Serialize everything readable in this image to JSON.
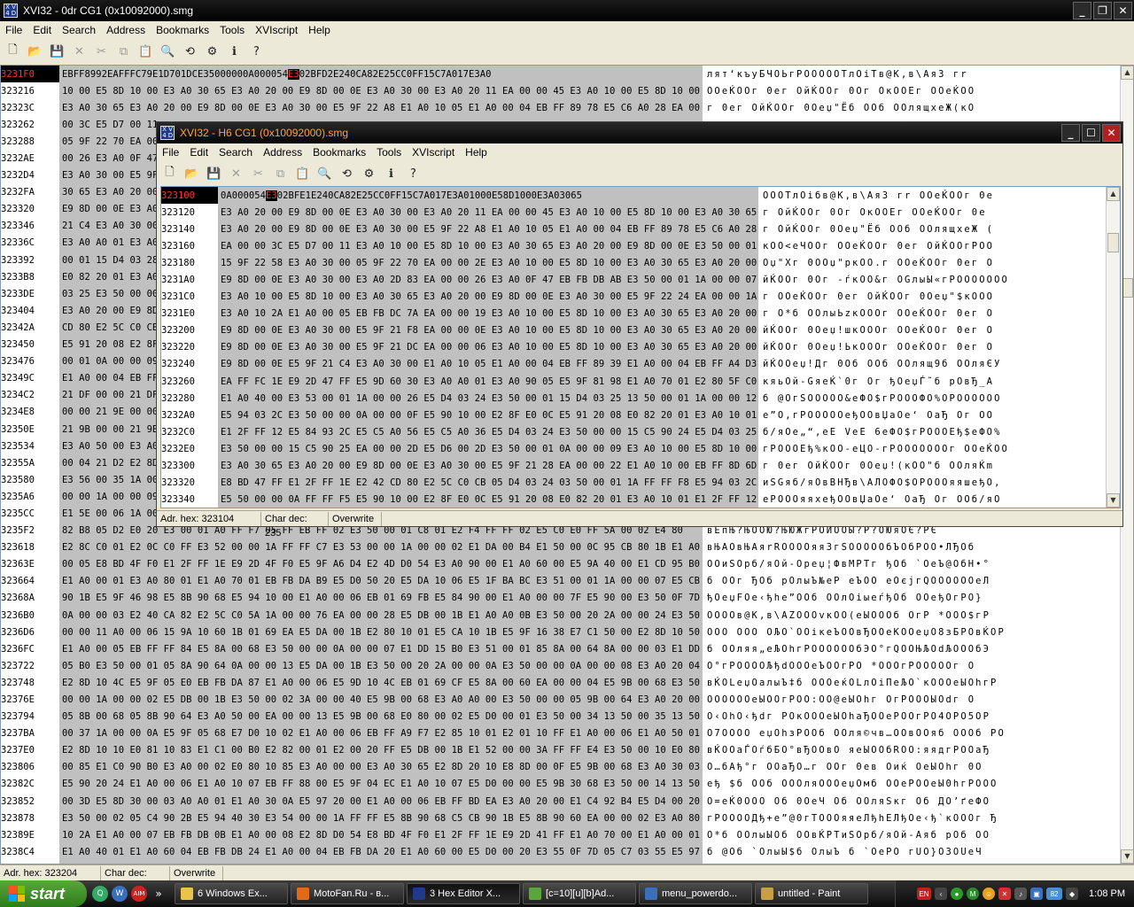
{
  "back_window": {
    "title": "XVI32 - 0dr CG1 (0x10092000).smg",
    "menu": [
      "File",
      "Edit",
      "Search",
      "Address",
      "Bookmarks",
      "Tools",
      "XVIscript",
      "Help"
    ],
    "status": {
      "adr_hex": "Adr. hex: 323204",
      "char_dec": "Char dec: 235",
      "mode": "Overwrite"
    },
    "rows": [
      {
        "addr": "3231F0",
        "hex": "EB FF 89 92 EA FF FC 79 E1 D7 01 DC E3 50 00 00 0A 00 00 54 E3 02 BF D2 E2 40 CA 82 E2 5C C0 FF 15 C7 A0 17 E3 A0",
        "text": "лят‘къуБЧОЬгРОООООТлОiТв@К,в\\АяЗ гr"
      },
      {
        "addr": "323216",
        "hex": "10 00 E5 8D 10 00 E3 A0 30 65 E3 A0 20 00 E9 8D 00 0E E3 A0 30 00 E3 A0 20 11 EA 00 00 45 E3 A0 10 00 E5 8D 10 00",
        "text": "ООеЌООг 0ег  ОйЌООг 0Ог  ОкООЕг ООеЌОО"
      },
      {
        "addr": "32323C",
        "hex": "E3 A0 30 65 E3 A0 20 00 E9 8D 00 0E E3 A0 30 00 E5 9F 22 A8 E1 A0 10 05 E1 A0 00 04 EB FF 89 78 E5 C6 A0 28 EA 00",
        "text": "г 0ег  ОйЌООг 0Оеџ\"Ёб ООб ООлящхеЖ(кО"
      },
      {
        "addr": "323262",
        "hex": "00 3C E5 D7 00 11",
        "text": ""
      },
      {
        "addr": "323288",
        "hex": "05 9F 22 70 EA 00",
        "text": ""
      },
      {
        "addr": "3232AE",
        "hex": "00 26 E3 A0 0F 47",
        "text": ""
      },
      {
        "addr": "3232D4",
        "hex": "E3 A0 30 00 E5 9F",
        "text": ""
      },
      {
        "addr": "3232FA",
        "hex": "30 65 E3 A0 20 00",
        "text": ""
      },
      {
        "addr": "323320",
        "hex": "E9 8D 00 0E E3 A0",
        "text": ""
      },
      {
        "addr": "323346",
        "hex": "21 C4 E3 A0 30 00",
        "text": ""
      },
      {
        "addr": "32336C",
        "hex": "E3 A0 A0 01 E3 A0",
        "text": ""
      },
      {
        "addr": "323392",
        "hex": "00 01 15 D4 03 28",
        "text": ""
      },
      {
        "addr": "3233B8",
        "hex": "E0 82 20 01 E3 A0",
        "text": ""
      },
      {
        "addr": "3233DE",
        "hex": "03 25 E3 50 00 00",
        "text": ""
      },
      {
        "addr": "323404",
        "hex": "E3 A0 20 00 E9 8D",
        "text": ""
      },
      {
        "addr": "32342A",
        "hex": "CD 80 E2 5C C0 CB",
        "text": ""
      },
      {
        "addr": "323450",
        "hex": "E5 91 20 08 E2 8F",
        "text": ""
      },
      {
        "addr": "323476",
        "hex": "00 01 0A 00 00 09",
        "text": ""
      },
      {
        "addr": "32349C",
        "hex": "E1 A0 00 04 EB FF",
        "text": ""
      },
      {
        "addr": "3234C2",
        "hex": "21 DF 00 00 21 DF",
        "text": ""
      },
      {
        "addr": "3234E8",
        "hex": "00 00 21 9E 00 00",
        "text": ""
      },
      {
        "addr": "32350E",
        "hex": "21 9B 00 00 21 9B",
        "text": ""
      },
      {
        "addr": "323534",
        "hex": "E3 A0 50 00 E3 A0",
        "text": ""
      },
      {
        "addr": "32355A",
        "hex": "00 04 21 D2 E2 8D",
        "text": ""
      },
      {
        "addr": "323580",
        "hex": "E3 56 00 35 1A 00",
        "text": ""
      },
      {
        "addr": "3235A6",
        "hex": "00 00 1A 00 00 09",
        "text": ""
      },
      {
        "addr": "3235CC",
        "hex": "E1 5E 00 06 1A 00",
        "text": ""
      },
      {
        "addr": "3235F2",
        "hex": "82 B8 05 D2 E0 20 E3 00 01 A0 FF F7 05 FF EB FF 02 E3 50 00 01 C8 01 E2 F4 FF FF 02 E5 C0 E0 FF 5A 00 02 E4 80",
        "text": "вЕпЊ?ЊООЮ?ЊЮЖгРОИООЫ?Р?ОЮяОЄ?РЄ"
      },
      {
        "addr": "323618",
        "hex": "E2 8C C0 01 E2 0C C0 FF E3 52 00 00 1A FF FF C7 E3 53 00 00 1A 00 00 02 E1 DA 00 B4 E1 50 00 0C 95 CB 80 1B E1 A0",
        "text": "вЊАОвЊАяrRООООяяЗгSОООООбЪОбРОО•ЛЂОб"
      },
      {
        "addr": "32363E",
        "hex": "00 05 E8 BD 4F F0 E1 2F FF 1E E9 2D 4F F0 E5 9F A6 D4 E2 4D D0 54 E3 A0 90 00 E1 A0 60 00 E5 9A 40 00 E1 CD 95 B0",
        "text": "ООиЅОрб/яОй-Ореџ¦ФвМРТг ђОб `ОеЪ@ОбН•°"
      },
      {
        "addr": "323664",
        "hex": "E1 A0 00 01 E3 A0 80 01 E1 A0 70 01 EB FB DA B9 E5 D0 50 20 E5 DA 10 06 E5 1F BA BC E3 51 00 01 1A 00 00 07 E5 CB",
        "text": "б ООг ЂОб pОлыЪ№еР еЪОО еОєјгQООООООеЛ"
      },
      {
        "addr": "32368A",
        "hex": "90 1B E5 9F 46 98 E5 8B 90 68 E5 94 10 00 E1 A0 00 06 EB 01 69 FB E5 84 90 00 E1 A0 00 00 7F E5 90 00 E3 50 0F 7D",
        "text": "ђОеџFОе‹ђhе”ООб ООлОiыеѓђОб ООеђОгPО}"
      },
      {
        "addr": "3236B0",
        "hex": "0A 00 00 03 E2 40 CA 82 E2 5C C0 5A 1A 00 00 76 EA 00 00 28 E5 DB 00 1B E1 A0 A0 0B E3 50 00 20 2A 00 00 24 E3 50",
        "text": "ОООOв@К,в\\АZОООvкОО(еЫОООб  ОгP *ООО$гР"
      },
      {
        "addr": "3236D6",
        "hex": "00 00 11 A0 00 06 15 9A 10 60 1B 01 69 EA E5 DA 00 1B E2 80 10 01 E5 CA 10 1B E5 9F 16 38 E7 C1 50 00 E2 8D 10 50",
        "text": "ООО ООО ОЉО`ООiкеЪООвЂООеКООеџО8зБРОвЌОР"
      },
      {
        "addr": "3236FC",
        "hex": "E1 A0 00 05 EB FF FF 84 E5 8A 00 68 E3 50 00 00 0A 00 00 07 E1 DD 15 B0 E3 51 00 01 85 8A 00 64 8A 00 00 03 E1 DD",
        "text": "б ООляя„еЉОhгРООООООбЭО°гQООЊЉОdЉОООбЭ"
      },
      {
        "addr": "323722",
        "hex": "05 B0 E3 50 00 01 05 8A 90 64 0A 00 00 13 E5 DA 00 1B E3 50 00 20 2A 00 00 0A E3 50 00 00 0A 00 00 08 E3 A0 20 04",
        "text": "О°гРООООЉђdОООеЪООгРО *ОООгРОООООг  О"
      },
      {
        "addr": "323748",
        "hex": "E2 8D 10 4C E5 9F 05 E0 EB FB DA 87 E1 A0 00 06 E5 9D 10 4C EB 01 69 CF E5 8A 00 60 EA 00 00 04 E5 9B 00 68 E3 50",
        "text": "вЌОLеџОалыЪ‡б ОООеќОLлОiПеЉО`кОООеЫОhгР"
      },
      {
        "addr": "32376E",
        "hex": "00 00 1A 00 00 02 E5 DB 00 1B E3 50 00 02 3A 00 00 40 E5 9B 00 68 E3 A0 A0 00 E3 50 00 00 05 9B 00 64 E3 A0 20 00",
        "text": "ООООООеЫООгРОО:ОО@еЫОhг  ОгРОООЫОdг  О"
      },
      {
        "addr": "323794",
        "hex": "05 8B 00 68 05 8B 90 64 E3 A0 50 00 EA 00 00 13 E5 9B 00 68 E0 80 00 02 E5 D0 00 01 E3 50 00 34 13 50 00 35 13 50",
        "text": "О‹ОhО‹ђdг POкОООеЫОhаЂООеРООгРО4ОРО5ОР"
      },
      {
        "addr": "3237BA",
        "hex": "00 37 1A 00 00 0A E5 9F 05 68 E7 D0 10 02 E1 A0 00 06 EB FF A9 F7 E2 85 10 01 E2 01 10 FF E1 A0 00 06 E1 A0 50 01",
        "text": "О7ОООО еџОhзРООб ООля©чв…ООвООяб ОООб РО"
      },
      {
        "addr": "3237E0",
        "hex": "E2 8D 10 10 E0 81 10 83 E1 C1 00 B0 E2 82 00 01 E2 00 20 FF E5 DB 00 1B E1 52 00 00 3A FF FF E4 E3 50 00 10 E0 80",
        "text": "вЌООаЃОѓбБО°вЂООвО яеЫООбRОО:яядгРООаЂ"
      },
      {
        "addr": "323806",
        "hex": "00 85 E1 C0 90 B0 E3 A0 00 02 E0 80 10 85 E3 A0 00 00 E3 A0 30 65 E2 8D 20 10 E8 8D 00 0F E5 9B 00 68 E3 A0 30 03",
        "text": "О…бАђ°г ООаЂО…г ООг 0ев Оиќ ОеЫОhг 0О"
      },
      {
        "addr": "32382C",
        "hex": "E5 90 20 24 E1 A0 00 06 E1 A0 10 07 EB FF 88 00 E5 9F 04 EC E1 A0 10 07 E5 D0 00 00 E5 9B 30 68 E3 50 00 14 13 50",
        "text": "еђ $б ООб ОООляОООеџОмб ООеРООеЫ0hгРООО"
      },
      {
        "addr": "323852",
        "hex": "00 3D E5 8D 30 00 03 A0 A0 01 E1 A0 30 0A E5 97 20 00 E1 A0 00 06 EB FF BD EA E3 A0 20 00 E1 C4 92 B4 E5 D4 00 20",
        "text": "О=еЌ0ООО  Об 0ОеЧ Об ООляЅкг Об ДО’ґеФО "
      },
      {
        "addr": "323878",
        "hex": "E3 50 00 02 05 C4 90 2B E5 94 40 30 E3 54 00 00 1A FF FF E5 8B 90 68 C5 CB 90 1B E5 8B 90 60 EA 00 00 02 E3 A0 80",
        "text": "гРООООДђ+е”@0гТОООяяеЛђhЕЛђОе‹ђ`кОООг Ђ"
      },
      {
        "addr": "32389E",
        "hex": "10 2A E1 A0 00 07 EB FB DB 0B E1 A0 00 08 E2 8D D0 54 E8 BD 4F F0 E1 2F FF 1E E9 2D 41 FF E1 A0 70 00 E1 A0 00 01",
        "text": "О*б ООлыЫОб ООвЌРТиЅОрб/яОй-Аяб pОб ОО"
      },
      {
        "addr": "3238C4",
        "hex": "E1 A0 40 01 E1 A0 60 04 EB FB DB 24 E1 A0 00 04 EB FB DA 20 E1 A0 60 00 E5 D0 00 20 E3 55 0F 7D 05 C7 03 55 E5 97",
        "text": "б @Об `ОлыЫ$б ОлыЪ б `ОеРО гUО}ОЗОUеЧ"
      }
    ]
  },
  "front_window": {
    "title": "XVI32 - H6 CG1 (0x10092000).smg",
    "menu": [
      "File",
      "Edit",
      "Search",
      "Address",
      "Bookmarks",
      "Tools",
      "XVIscript",
      "Help"
    ],
    "status": {
      "adr_hex": "Adr. hex: 323104",
      "char_dec": "Char dec: 235",
      "mode": "Overwrite"
    },
    "rows": [
      {
        "addr": "323100",
        "hex": "0A 00 00 54 E3 02 BF E1 E2 40 CA 82 E2 5C C0 FF 15 C7 A0 17 E3 A0 10 00 E5 8D 10 00 E3 A0 30 65",
        "text": "ОООТлОiбв@К,в\\АяЗ гr ООеЌООг 0е"
      },
      {
        "addr": "323120",
        "hex": "E3 A0 20 00 E9 8D 00 0E E3 A0 30 00 E3 A0 20 11 EA 00 00 45 E3 A0 10 00 E5 8D 10 00 E3 A0 30 65",
        "text": "г  ОйЌООг 0Ог  ОкООЕг ООеЌООг 0е"
      },
      {
        "addr": "323140",
        "hex": "E3 A0 20 00 E9 8D 00 0E E3 A0 30 00 E5 9F 22 A8 E1 A0 10 05 E1 A0 00 04 EB FF 89 78 E5 C6 A0 28",
        "text": "г  ОйЌООг 0Оеџ\"Ёб ООб ООлящхеЖ ("
      },
      {
        "addr": "323160",
        "hex": "EA 00 00 3C E5 D7 00 11 E3 A0 10 00 E5 8D 10 00 E3 A0 30 65 E3 A0 20 00 E9 8D 00 0E E3 50 00 01",
        "text": "кОО<еЧООг ООеЌООг 0ег  ОйЌООгРОО"
      },
      {
        "addr": "323180",
        "hex": "15 9F 22 58 E3 A0 30 00 05 9F 22 70 EA 00 00 2E E3 A0 10 00 E5 8D 10 00 E3 A0 30 65 E3 A0 20 00",
        "text": "Оџ\"Хг 0ООџ\"pкОО.г ООеЌООг 0ег  О"
      },
      {
        "addr": "3231A0",
        "hex": "E9 8D 00 0E E3 A0 30 00 E3 A0 2D 83 EA 00 00 26 E3 A0 0F 47 EB FB DB AB E3 50 00 01 1A 00 00 07",
        "text": "йЌООг 0Ог -ѓкОО&г ОGлыЫ«гРООООООО"
      },
      {
        "addr": "3231C0",
        "hex": "E3 A0 10 00 E5 8D 10 00 E3 A0 30 65 E3 A0 20 00 E9 8D 00 0E E3 A0 30 00 E5 9F 22 24 EA 00 00 1A",
        "text": "г ООеЌООг 0ег  ОйЌООг 0Оеџ\"$кООО"
      },
      {
        "addr": "3231E0",
        "hex": "E3 A0 10 2A E1 A0 00 05 EB FB DC 7A EA 00 00 19 E3 A0 10 00 E5 8D 10 00 E3 A0 30 65 E3 A0 20 00",
        "text": "г О*б ООлыЬzкОООг ООеЌООг 0ег  О"
      },
      {
        "addr": "323200",
        "hex": "E9 8D 00 0E E3 A0 30 00 E5 9F 21 F8 EA 00 00 0E E3 A0 10 00 E5 8D 10 00 E3 A0 30 65 E3 A0 20 00",
        "text": "йЌООг 0Оеџ!шкОООг ООеЌООг 0ег  О"
      },
      {
        "addr": "323220",
        "hex": "E9 8D 00 0E E3 A0 30 00 E5 9F 21 DC EA 00 00 06 E3 A0 10 00 E5 8D 10 00 E3 A0 30 65 E3 A0 20 00",
        "text": "йЌООг 0Оеџ!ЬкОООг ООеЌООг 0ег  О"
      },
      {
        "addr": "323240",
        "hex": "E9 8D 00 0E E5 9F 21 C4 E3 A0 30 00 E1 A0 10 05 E1 A0 00 04 EB FF 89 39 E1 A0 00 04 EB FF A4 D3",
        "text": "йЌООеџ!Дг 0Об ООб ООлящ9б ООляЄУ"
      },
      {
        "addr": "323260",
        "hex": "EA FF FC 1E E9 2D 47 FF E5 9D 60 30 E3 A0 A0 01 E3 A0 90 05 E5 9F 81 98 E1 A0 70 01 E2 80 5F C0",
        "text": "кяьОй-GяеЌ`0г  Ог ђОеџЃ˜б pОвЂ_А"
      },
      {
        "addr": "323280",
        "hex": "E1 A0 40 00 E3 53 00 01 1A 00 00 26 E5 D4 03 24 E3 50 00 01 15 D4 03 25 13 50 00 01 1A 00 00 12",
        "text": "б @ОгSООООО&еФО$гРОООФО%ОРОООООО"
      },
      {
        "addr": "3232A0",
        "hex": "E5 94 03 2C E3 50 00 00 0A 00 00 0F E5 90 10 00 E2 8F E0 0C E5 91 20 08 E0 82 20 01 E3 A0 10 01",
        "text": "е”О,гРОООООеђООвЏаОе‘ ОаЂ Ог ОО"
      },
      {
        "addr": "3232C0",
        "hex": "E1 2F FF 12 E5 84 93 2C E5 C5 A0 56 E5 C5 A0 36 E5 D4 03 24 E3 50 00 00 15 C5 90 24 E5 D4 03 25",
        "text": "б/яОе„“,еЕ VеЕ 6еФО$гРОООЕђ$еФО%"
      },
      {
        "addr": "3232E0",
        "hex": "E3 50 00 00 15 C5 90 25 EA 00 00 2D E5 D6 00 2D E3 50 00 01 0A 00 00 09 E3 A0 10 00 E5 8D 10 00",
        "text": "гРОООЕђ%кОО-еЦО-гРОООООООг ООеЌОО"
      },
      {
        "addr": "323300",
        "hex": "E3 A0 30 65 E3 A0 20 00 E9 8D 00 0E E3 A0 30 00 E5 9F 21 28 EA 00 00 22 E1 A0 10 00 EB FF 8D 6D",
        "text": "г 0ег  ОйЌООг 0Оеџ!(кОО\"б ООляЌm"
      },
      {
        "addr": "323320",
        "hex": "E8 BD 47 FF E1 2F FF 1E E2 42 CD 80 E2 5C C0 CB 05 D4 03 24 03 50 00 01 1A FF FF F8 E5 94 03 2C",
        "text": "иЅGяб/яОвBНЂв\\АЛОФО$ОРОООяяшеђО,"
      },
      {
        "addr": "323340",
        "hex": "E5 50 00 00 0A FF FF F5 E5 90 10 00 E2 8F E0 0C E5 91 20 08 E0 82 20 01 E3 A0 10 01 E1 2F FF 12",
        "text": "еРОООяяхеђООвЏаОе‘ ОаЂ Ог ООб/яО"
      }
    ]
  },
  "taskbar": {
    "start_label": "start",
    "quick_launch": [
      "Q",
      "W",
      "AIM"
    ],
    "tasks": [
      {
        "label": "6 Windows Ex...",
        "color": "#e8c44a"
      },
      {
        "label": "MotoFan.Ru - в...",
        "color": "#e06a1a"
      },
      {
        "label": "3 Hex Editor X...",
        "color": "#203a8a"
      },
      {
        "label": "[c=10][u][b]Ad...",
        "color": "#5aa63b"
      },
      {
        "label": "menu_powerdo...",
        "color": "#3a6fc0"
      },
      {
        "label": "untitled - Paint",
        "color": "#c8a040"
      }
    ],
    "tray_icons": [
      "EN",
      "M",
      "82"
    ],
    "clock": "1:08 PM"
  }
}
